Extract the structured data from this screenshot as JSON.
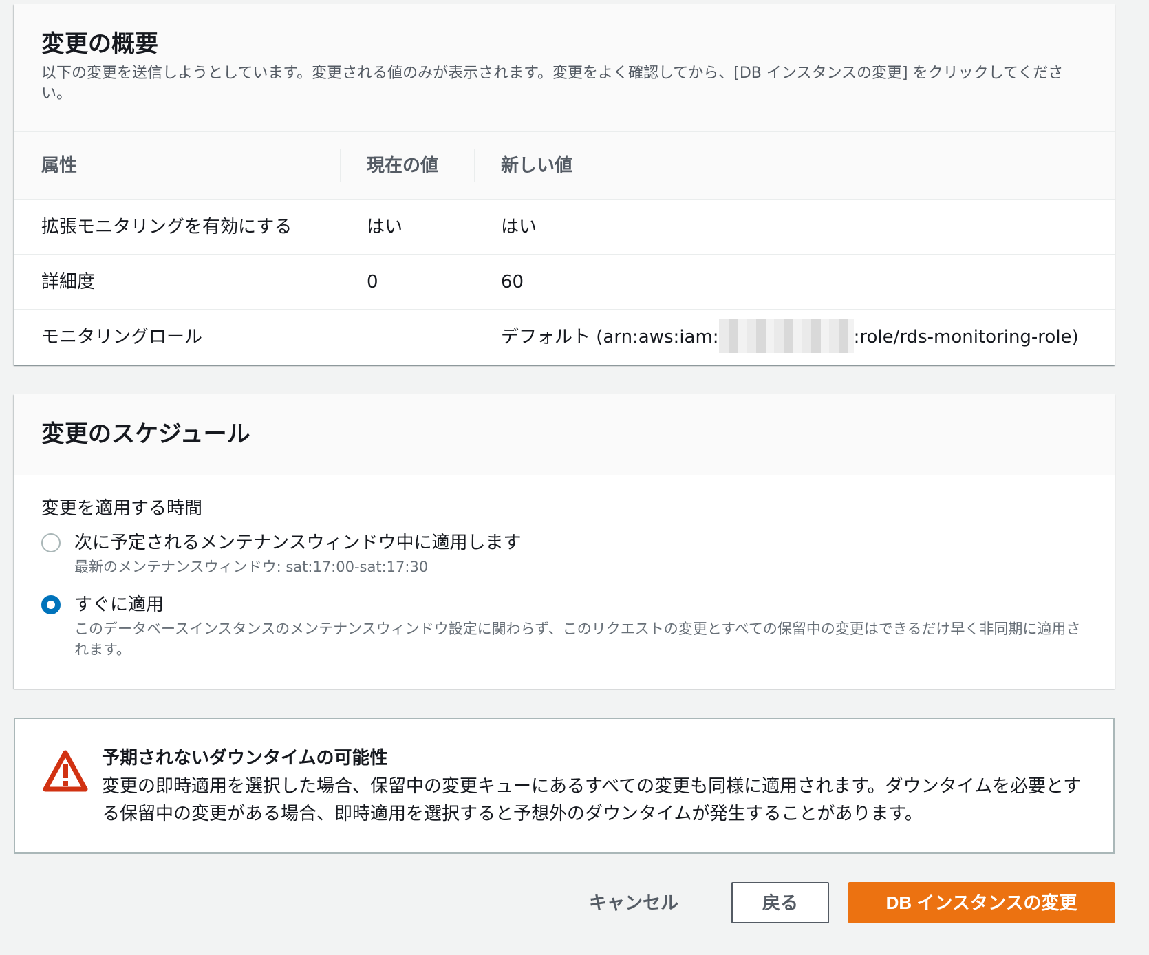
{
  "summary": {
    "title": "変更の概要",
    "description": "以下の変更を送信しようとしています。変更される値のみが表示されます。変更をよく確認してから、[DB インスタンスの変更] をクリックしてください。",
    "columns": {
      "attribute": "属性",
      "current": "現在の値",
      "new": "新しい値"
    },
    "rows": [
      {
        "attribute": "拡張モニタリングを有効にする",
        "current": "はい",
        "new": "はい"
      },
      {
        "attribute": "詳細度",
        "current": "0",
        "new": "60"
      },
      {
        "attribute": "モニタリングロール",
        "current": "",
        "new_prefix": "デフォルト (arn:aws:iam:",
        "new_suffix": ":role/rds-monitoring-role)"
      }
    ]
  },
  "schedule": {
    "title": "変更のスケジュール",
    "field_label": "変更を適用する時間",
    "options": [
      {
        "label": "次に予定されるメンテナンスウィンドウ中に適用します",
        "description": "最新のメンテナンスウィンドウ: sat:17:00-sat:17:30",
        "selected": false
      },
      {
        "label": "すぐに適用",
        "description": "このデータベースインスタンスのメンテナンスウィンドウ設定に関わらず、このリクエストの変更とすべての保留中の変更はできるだけ早く非同期に適用されます。",
        "selected": true
      }
    ]
  },
  "alert": {
    "icon": "warning-triangle-icon",
    "title": "予期されないダウンタイムの可能性",
    "text": "変更の即時適用を選択した場合、保留中の変更キューにあるすべての変更も同様に適用されます。ダウンタイムを必要とする保留中の変更がある場合、即時適用を選択すると予想外のダウンタイムが発生することがあります。"
  },
  "actions": {
    "cancel": "キャンセル",
    "back": "戻る",
    "modify": "DB インスタンスの変更"
  },
  "colors": {
    "primary": "#ec7211",
    "radio_selected": "#0073bb",
    "warning": "#d13212"
  }
}
